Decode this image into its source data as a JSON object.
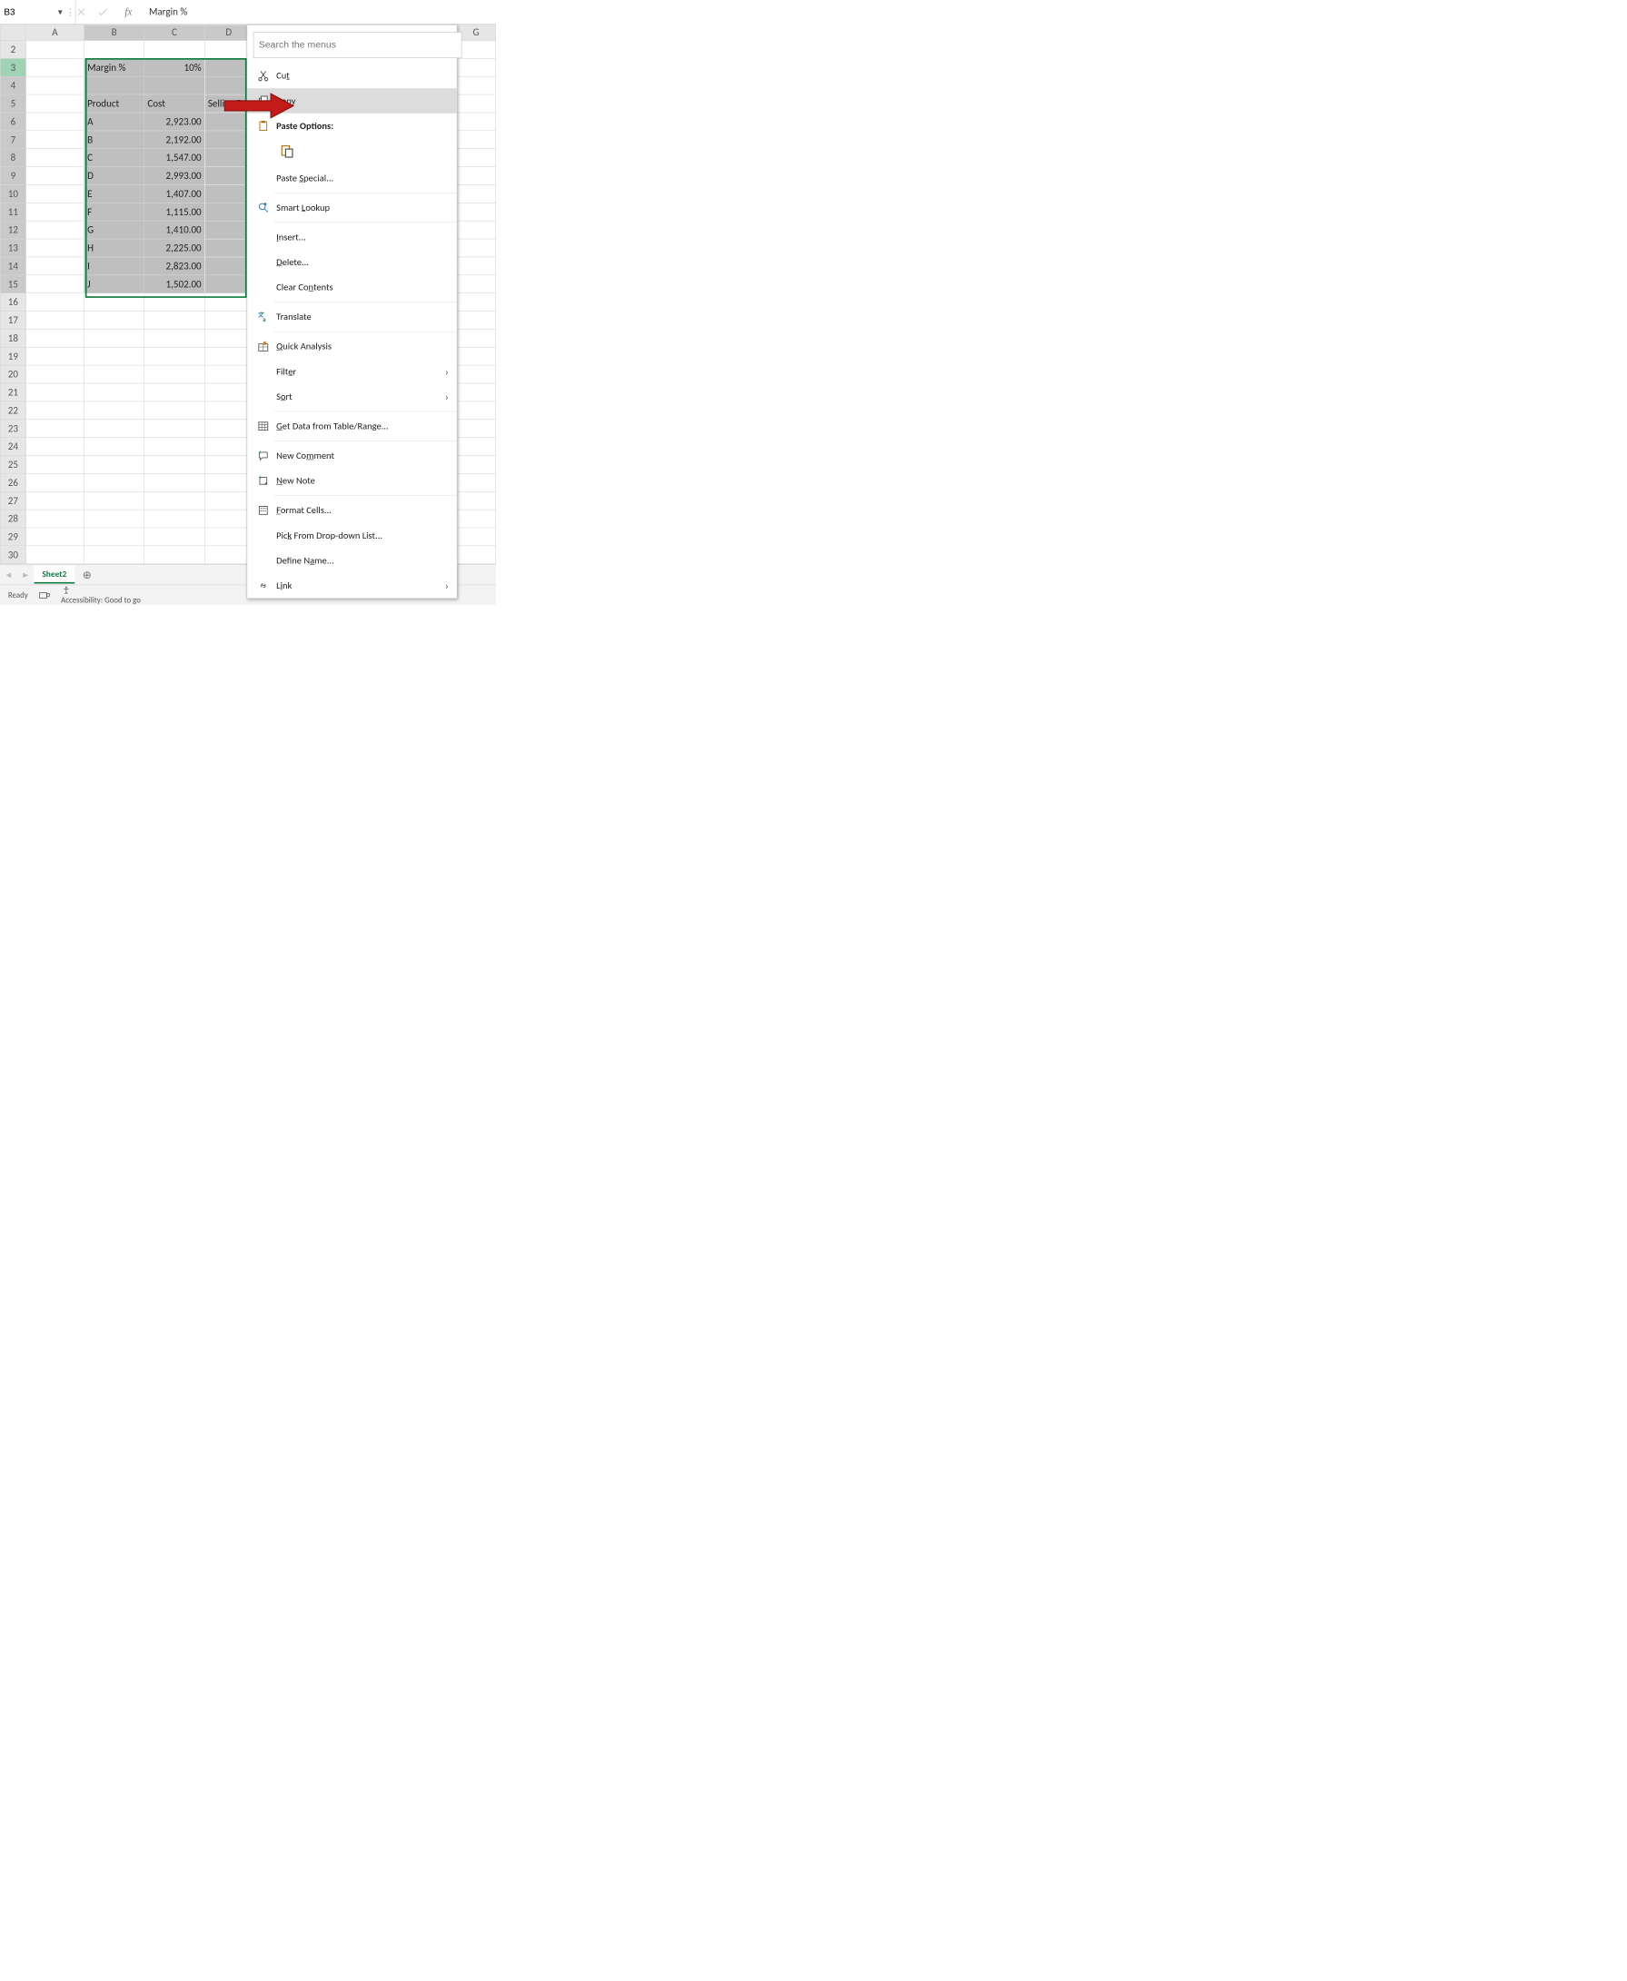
{
  "formula_bar": {
    "name_box": "B3",
    "content": "Margin %"
  },
  "columns": [
    "A",
    "B",
    "C",
    "D",
    "G"
  ],
  "row_numbers": [
    2,
    3,
    4,
    5,
    6,
    7,
    8,
    9,
    10,
    11,
    12,
    13,
    14,
    15,
    16,
    17,
    18,
    19,
    20,
    21,
    22,
    23,
    24,
    25,
    26,
    27,
    28,
    29,
    30
  ],
  "table": {
    "margin_label": "Margin %",
    "margin_value": "10%",
    "headers": {
      "product": "Product",
      "cost": "Cost",
      "selling": "Selling P"
    },
    "rows": [
      {
        "p": "A",
        "c": "2,923.00"
      },
      {
        "p": "B",
        "c": "2,192.00"
      },
      {
        "p": "C",
        "c": "1,547.00"
      },
      {
        "p": "D",
        "c": "2,993.00"
      },
      {
        "p": "E",
        "c": "1,407.00"
      },
      {
        "p": "F",
        "c": "1,115.00"
      },
      {
        "p": "G",
        "c": "1,410.00"
      },
      {
        "p": "H",
        "c": "2,225.00"
      },
      {
        "p": "I",
        "c": "2,823.00"
      },
      {
        "p": "J",
        "c": "1,502.00"
      }
    ]
  },
  "context_menu": {
    "search_placeholder": "Search the menus",
    "cut": "Cut",
    "copy": "Copy",
    "paste_options": "Paste Options:",
    "paste_special": "Paste Special...",
    "smart_lookup": "Smart Lookup",
    "insert": "Insert...",
    "delete": "Delete...",
    "clear_contents": "Clear Contents",
    "translate": "Translate",
    "quick_analysis": "Quick Analysis",
    "filter": "Filter",
    "sort": "Sort",
    "get_data": "Get Data from Table/Range...",
    "new_comment": "New Comment",
    "new_note": "New Note",
    "format_cells": "Format Cells...",
    "pick_list": "Pick From Drop-down List...",
    "define_name": "Define Name...",
    "link": "Link"
  },
  "tabs": {
    "active": "Sheet2"
  },
  "status": {
    "ready": "Ready",
    "accessibility": "Accessibility: Good to go"
  }
}
